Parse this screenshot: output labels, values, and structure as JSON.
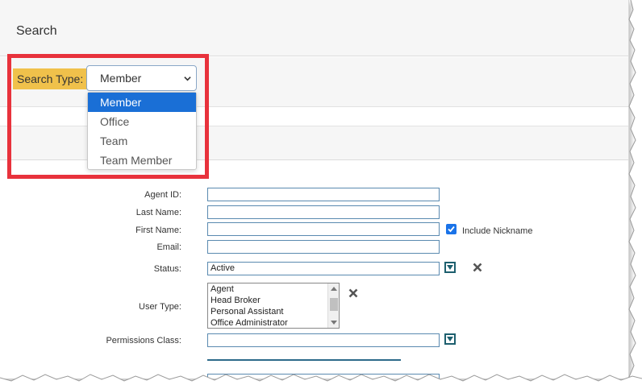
{
  "header": {
    "title": "Search"
  },
  "search_type": {
    "label": "Search Type:",
    "selected": "Member",
    "options": [
      "Member",
      "Office",
      "Team",
      "Team Member"
    ]
  },
  "form": {
    "agent_id_label": "Agent ID:",
    "last_name_label": "Last Name:",
    "first_name_label": "First Name:",
    "include_nickname_label": "Include Nickname",
    "include_nickname_checked": true,
    "email_label": "Email:",
    "status_label": "Status:",
    "status_value": "Active",
    "user_type_label": "User Type:",
    "user_type_options": [
      "Agent",
      "Head Broker",
      "Personal Assistant",
      "Office Administrator"
    ],
    "permissions_class_label": "Permissions Class:"
  },
  "colors": {
    "label_highlight": "#f0c14b",
    "selected_option": "#1a6fd6",
    "annotation_box": "#e8323c",
    "button_border": "#1d5f6e"
  }
}
